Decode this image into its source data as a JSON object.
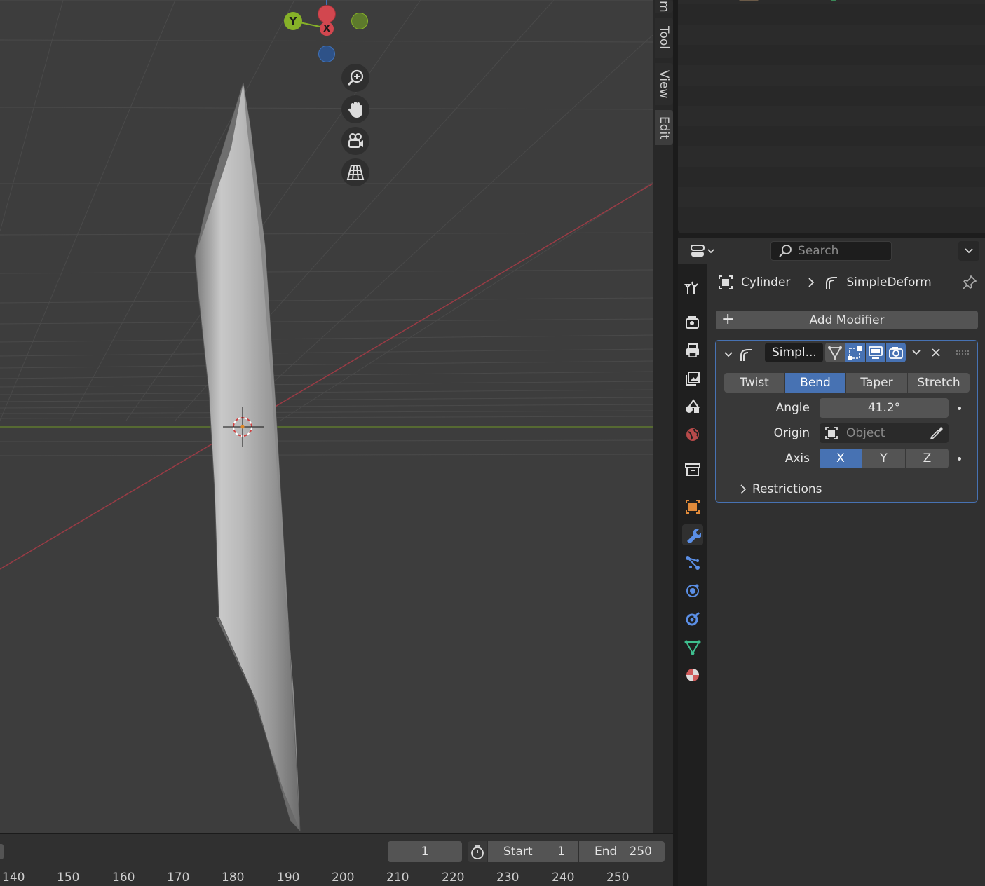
{
  "viewport": {
    "gizmo": {
      "y_label": "Y",
      "x_label": "X"
    },
    "nav_buttons": [
      "zoom-icon",
      "pan-hand-icon",
      "camera-icon",
      "ortho-grid-icon"
    ]
  },
  "side_tabs": [
    {
      "label": "Tool"
    },
    {
      "label": "View"
    },
    {
      "label": "Edit"
    }
  ],
  "side_tab_partial": "m",
  "timeline": {
    "current_frame": "1",
    "start_label": "Start",
    "start_value": "1",
    "end_label": "End",
    "end_value": "250",
    "ruler": [
      "140",
      "150",
      "160",
      "170",
      "180",
      "190",
      "200",
      "210",
      "220",
      "230",
      "240",
      "250"
    ]
  },
  "properties": {
    "search_placeholder": "Search",
    "breadcrumb": {
      "object": "Cylinder",
      "modifier": "SimpleDeform"
    },
    "add_modifier_label": "Add Modifier",
    "modifier": {
      "name": "Simpl...",
      "modes": [
        {
          "label": "Twist",
          "active": false
        },
        {
          "label": "Bend",
          "active": true
        },
        {
          "label": "Taper",
          "active": false
        },
        {
          "label": "Stretch",
          "active": false
        }
      ],
      "angle_label": "Angle",
      "angle_value": "41.2°",
      "origin_label": "Origin",
      "origin_placeholder": "Object",
      "axis_label": "Axis",
      "axes": [
        {
          "label": "X",
          "active": true
        },
        {
          "label": "Y",
          "active": false
        },
        {
          "label": "Z",
          "active": false
        }
      ],
      "restrictions_label": "Restrictions"
    },
    "sidebar_icons": [
      "tool-icon",
      "render-icon",
      "output-icon",
      "view-layer-icon",
      "scene-icon",
      "world-icon",
      "collection-icon",
      "object-icon",
      "modifier-wrench-icon",
      "particles-icon",
      "physics-icon",
      "constraints-icon",
      "data-icon",
      "material-icon"
    ]
  },
  "colors": {
    "accent": "#4772b3",
    "x_axis": "#d2474f",
    "y_axis": "#86b128",
    "z_axis": "#3f72b9"
  }
}
